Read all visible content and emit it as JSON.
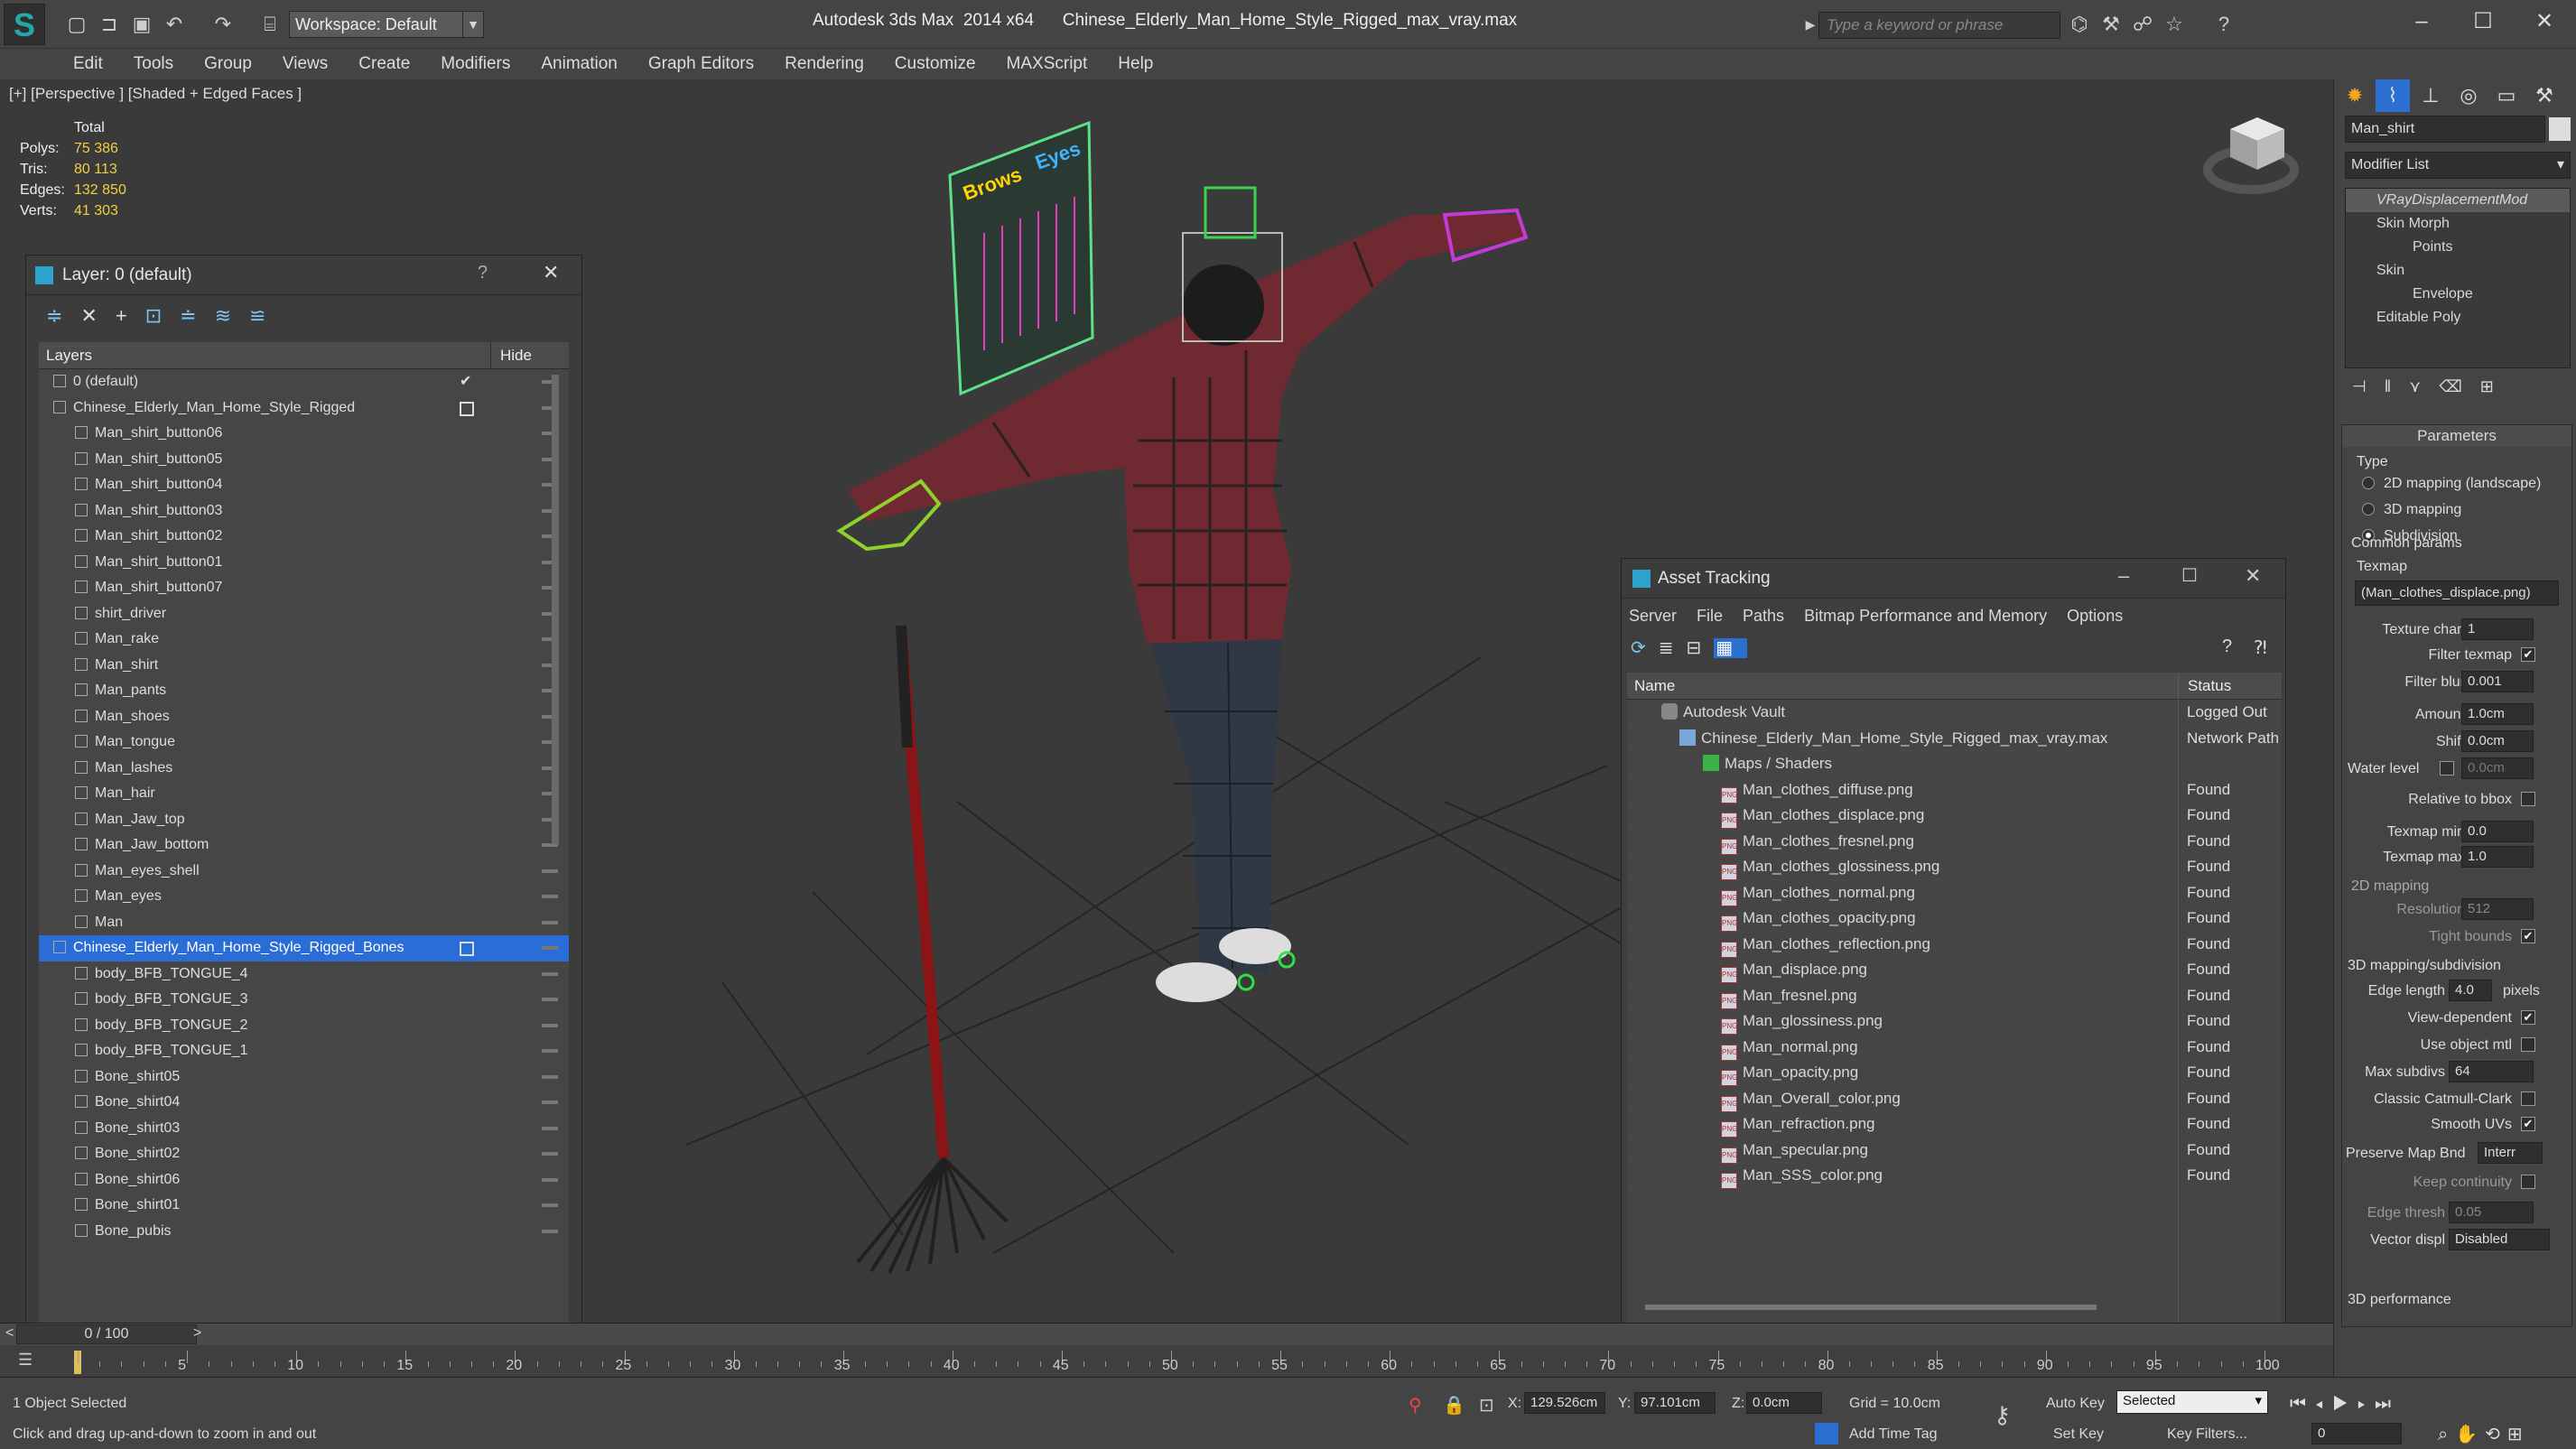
{
  "titlebar": {
    "workspace_label": "Workspace: Default",
    "app_title": "Autodesk 3ds Max  2014 x64",
    "file_title": "Chinese_Elderly_Man_Home_Style_Rigged_max_vray.max",
    "search_placeholder": "Type a keyword or phrase"
  },
  "menu": [
    "Edit",
    "Tools",
    "Group",
    "Views",
    "Create",
    "Modifiers",
    "Animation",
    "Graph Editors",
    "Rendering",
    "Customize",
    "MAXScript",
    "Help"
  ],
  "viewport": {
    "label": "[+] [Perspective ] [Shaded + Edged Faces ]",
    "stats": {
      "header": "Total",
      "rows": [
        {
          "k": "Polys:",
          "v": "75 386"
        },
        {
          "k": "Tris:",
          "v": "80 113"
        },
        {
          "k": "Edges:",
          "v": "132 850"
        },
        {
          "k": "Verts:",
          "v": "41 303"
        }
      ]
    },
    "board_texts": [
      "Brows",
      "Eyes"
    ]
  },
  "layers": {
    "title": "Layer: 0 (default)",
    "col_layers": "Layers",
    "col_hide": "Hide",
    "help": "?",
    "rows": [
      {
        "name": "0 (default)",
        "indent": 1,
        "check": "✔"
      },
      {
        "name": "Chinese_Elderly_Man_Home_Style_Rigged",
        "indent": 1,
        "box": true
      },
      {
        "name": "Man_shirt_button06",
        "indent": 2
      },
      {
        "name": "Man_shirt_button05",
        "indent": 2
      },
      {
        "name": "Man_shirt_button04",
        "indent": 2
      },
      {
        "name": "Man_shirt_button03",
        "indent": 2
      },
      {
        "name": "Man_shirt_button02",
        "indent": 2
      },
      {
        "name": "Man_shirt_button01",
        "indent": 2
      },
      {
        "name": "Man_shirt_button07",
        "indent": 2
      },
      {
        "name": "shirt_driver",
        "indent": 2
      },
      {
        "name": "Man_rake",
        "indent": 2
      },
      {
        "name": "Man_shirt",
        "indent": 2
      },
      {
        "name": "Man_pants",
        "indent": 2
      },
      {
        "name": "Man_shoes",
        "indent": 2
      },
      {
        "name": "Man_tongue",
        "indent": 2
      },
      {
        "name": "Man_lashes",
        "indent": 2
      },
      {
        "name": "Man_hair",
        "indent": 2
      },
      {
        "name": "Man_Jaw_top",
        "indent": 2
      },
      {
        "name": "Man_Jaw_bottom",
        "indent": 2
      },
      {
        "name": "Man_eyes_shell",
        "indent": 2
      },
      {
        "name": "Man_eyes",
        "indent": 2
      },
      {
        "name": "Man",
        "indent": 2
      },
      {
        "name": "Chinese_Elderly_Man_Home_Style_Rigged_Bones",
        "indent": 1,
        "box": true,
        "selected": true
      },
      {
        "name": "body_BFB_TONGUE_4",
        "indent": 2
      },
      {
        "name": "body_BFB_TONGUE_3",
        "indent": 2
      },
      {
        "name": "body_BFB_TONGUE_2",
        "indent": 2
      },
      {
        "name": "body_BFB_TONGUE_1",
        "indent": 2
      },
      {
        "name": "Bone_shirt05",
        "indent": 2
      },
      {
        "name": "Bone_shirt04",
        "indent": 2
      },
      {
        "name": "Bone_shirt03",
        "indent": 2
      },
      {
        "name": "Bone_shirt02",
        "indent": 2
      },
      {
        "name": "Bone_shirt06",
        "indent": 2
      },
      {
        "name": "Bone_shirt01",
        "indent": 2
      },
      {
        "name": "Bone_pubis",
        "indent": 2
      }
    ]
  },
  "asset_tracking": {
    "title": "Asset Tracking",
    "menu": [
      "Server",
      "File",
      "Paths",
      "Bitmap Performance and Memory",
      "Options"
    ],
    "col_name": "Name",
    "col_status": "Status",
    "rows": [
      {
        "name": "Autodesk Vault",
        "status": "Logged Out",
        "indent": 1,
        "kind": "vault"
      },
      {
        "name": "Chinese_Elderly_Man_Home_Style_Rigged_max_vray.max",
        "status": "Network Path",
        "indent": 2,
        "kind": "max"
      },
      {
        "name": "Maps / Shaders",
        "status": "",
        "indent": 3,
        "kind": "maps"
      },
      {
        "name": "Man_clothes_diffuse.png",
        "status": "Found",
        "indent": 4,
        "kind": "png"
      },
      {
        "name": "Man_clothes_displace.png",
        "status": "Found",
        "indent": 4,
        "kind": "png"
      },
      {
        "name": "Man_clothes_fresnel.png",
        "status": "Found",
        "indent": 4,
        "kind": "png"
      },
      {
        "name": "Man_clothes_glossiness.png",
        "status": "Found",
        "indent": 4,
        "kind": "png"
      },
      {
        "name": "Man_clothes_normal.png",
        "status": "Found",
        "indent": 4,
        "kind": "png"
      },
      {
        "name": "Man_clothes_opacity.png",
        "status": "Found",
        "indent": 4,
        "kind": "png"
      },
      {
        "name": "Man_clothes_reflection.png",
        "status": "Found",
        "indent": 4,
        "kind": "png"
      },
      {
        "name": "Man_displace.png",
        "status": "Found",
        "indent": 4,
        "kind": "png"
      },
      {
        "name": "Man_fresnel.png",
        "status": "Found",
        "indent": 4,
        "kind": "png"
      },
      {
        "name": "Man_glossiness.png",
        "status": "Found",
        "indent": 4,
        "kind": "png"
      },
      {
        "name": "Man_normal.png",
        "status": "Found",
        "indent": 4,
        "kind": "png"
      },
      {
        "name": "Man_opacity.png",
        "status": "Found",
        "indent": 4,
        "kind": "png"
      },
      {
        "name": "Man_Overall_color.png",
        "status": "Found",
        "indent": 4,
        "kind": "png"
      },
      {
        "name": "Man_refraction.png",
        "status": "Found",
        "indent": 4,
        "kind": "png"
      },
      {
        "name": "Man_specular.png",
        "status": "Found",
        "indent": 4,
        "kind": "png"
      },
      {
        "name": "Man_SSS_color.png",
        "status": "Found",
        "indent": 4,
        "kind": "png"
      }
    ]
  },
  "command_panel": {
    "object_name": "Man_shirt",
    "modifier_list": "Modifier List",
    "stack": [
      {
        "name": "VRayDisplacementMod",
        "italic": true,
        "selected": true
      },
      {
        "name": "Skin Morph",
        "sub": false
      },
      {
        "name": "Points",
        "sub": true
      },
      {
        "name": "Skin",
        "sub": false
      },
      {
        "name": "Envelope",
        "sub": true
      },
      {
        "name": "Editable Poly",
        "sub": false
      }
    ],
    "parameters_title": "Parameters",
    "type_label": "Type",
    "type_options": [
      {
        "label": "2D mapping (landscape)",
        "on": false
      },
      {
        "label": "3D mapping",
        "on": false
      },
      {
        "label": "Subdivision",
        "on": true
      }
    ],
    "common_params": "Common params",
    "texmap_label": "Texmap",
    "texmap_value": "(Man_clothes_displace.png)",
    "texture_chan_label": "Texture chan",
    "texture_chan_value": "1",
    "filter_texmap_label": "Filter texmap",
    "filter_blur_label": "Filter blur",
    "filter_blur_value": "0.001",
    "amount_label": "Amount",
    "amount_value": "1.0cm",
    "shift_label": "Shift",
    "shift_value": "0.0cm",
    "water_level_label": "Water level",
    "water_level_value": "0.0cm",
    "relative_bbox_label": "Relative to bbox",
    "texmap_min_label": "Texmap min",
    "texmap_min_value": "0.0",
    "texmap_max_label": "Texmap max",
    "texmap_max_value": "1.0",
    "mapping2d_title": "2D mapping",
    "resolution_label": "Resolution",
    "resolution_value": "512",
    "tight_bounds_label": "Tight bounds",
    "mapping3d_title": "3D mapping/subdivision",
    "edge_length_label": "Edge length",
    "edge_length_value": "4.0",
    "pixels_label": "pixels",
    "view_dependent_label": "View-dependent",
    "use_object_mtl_label": "Use object mtl",
    "max_subdivs_label": "Max subdivs",
    "max_subdivs_value": "64",
    "classic_catmull_label": "Classic Catmull-Clark",
    "smooth_uvs_label": "Smooth UVs",
    "preserve_map_label": "Preserve Map Bnd",
    "preserve_map_value": "Interr",
    "keep_continuity_label": "Keep continuity",
    "edge_thresh_label": "Edge thresh",
    "edge_thresh_value": "0.05",
    "vector_displ_label": "Vector displ",
    "vector_displ_value": "Disabled",
    "perf_title": "3D performance"
  },
  "timeline": {
    "frame_label": "0 / 100",
    "ticks": [
      "0",
      "5",
      "10",
      "15",
      "20",
      "25",
      "30",
      "35",
      "40",
      "45",
      "50",
      "55",
      "60",
      "65",
      "70",
      "75",
      "80",
      "85",
      "90",
      "95",
      "100"
    ]
  },
  "status": {
    "selected": "1 Object Selected",
    "prompt": "Click and drag up-and-down to zoom in and out",
    "x_label": "X:",
    "x_value": "129.526cm",
    "y_label": "Y:",
    "y_value": "97.101cm",
    "z_label": "Z:",
    "z_value": "0.0cm",
    "grid": "Grid = 10.0cm",
    "auto_key": "Auto Key",
    "set_key": "Set Key",
    "selected_dropdown": "Selected",
    "key_filters": "Key Filters...",
    "add_time_tag": "Add Time Tag",
    "frame_value": "0"
  }
}
